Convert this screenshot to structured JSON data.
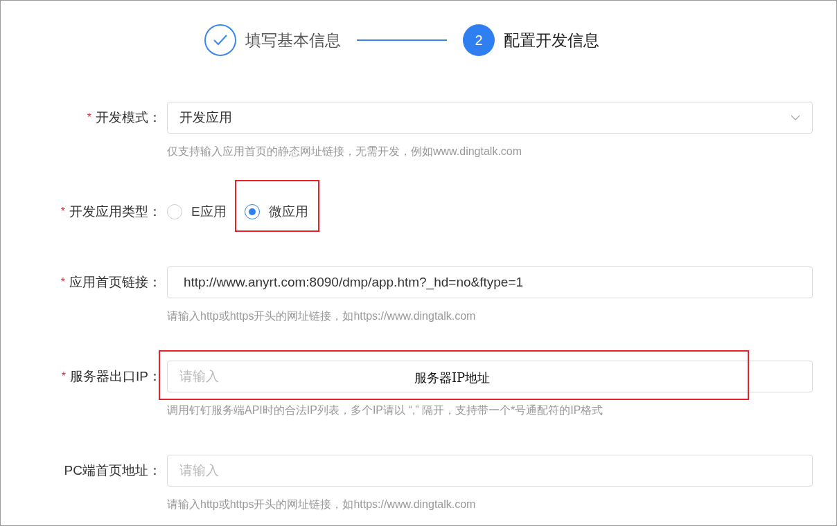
{
  "steps": [
    {
      "label": "填写基本信息",
      "completed": true
    },
    {
      "number": "2",
      "label": "配置开发信息",
      "completed": false
    }
  ],
  "fields": [
    {
      "kind": "select",
      "label": "开发模式：",
      "required_mark": "*",
      "value": "开发应用",
      "help": "仅支持输入应用首页的静态网址链接，无需开发，例如www.dingtalk.com"
    },
    {
      "kind": "radio",
      "label": "开发应用类型：",
      "required_mark": "*",
      "options": [
        {
          "label": "E应用",
          "selected": false,
          "highlighted": false
        },
        {
          "label": "微应用",
          "selected": true,
          "highlighted": true
        }
      ]
    },
    {
      "kind": "input",
      "label": "应用首页链接：",
      "required_mark": "*",
      "value": "http://www.anyrt.com:8090/dmp/app.htm?_hd=no&ftype=1",
      "help": "请输入http或https开头的网址链接，如https://www.dingtalk.com"
    },
    {
      "kind": "input",
      "label": "服务器出口IP：",
      "required_mark": "*",
      "placeholder": "请输入",
      "note": "服务器IP地址",
      "highlighted": true,
      "help": "调用钉钉服务端API时的合法IP列表，多个IP请以 “,” 隔开，支持带一个*号通配符的IP格式"
    },
    {
      "kind": "input",
      "label": "PC端首页地址：",
      "placeholder": "请输入",
      "help": "请输入http或https开头的网址链接，如https://www.dingtalk.com"
    }
  ]
}
